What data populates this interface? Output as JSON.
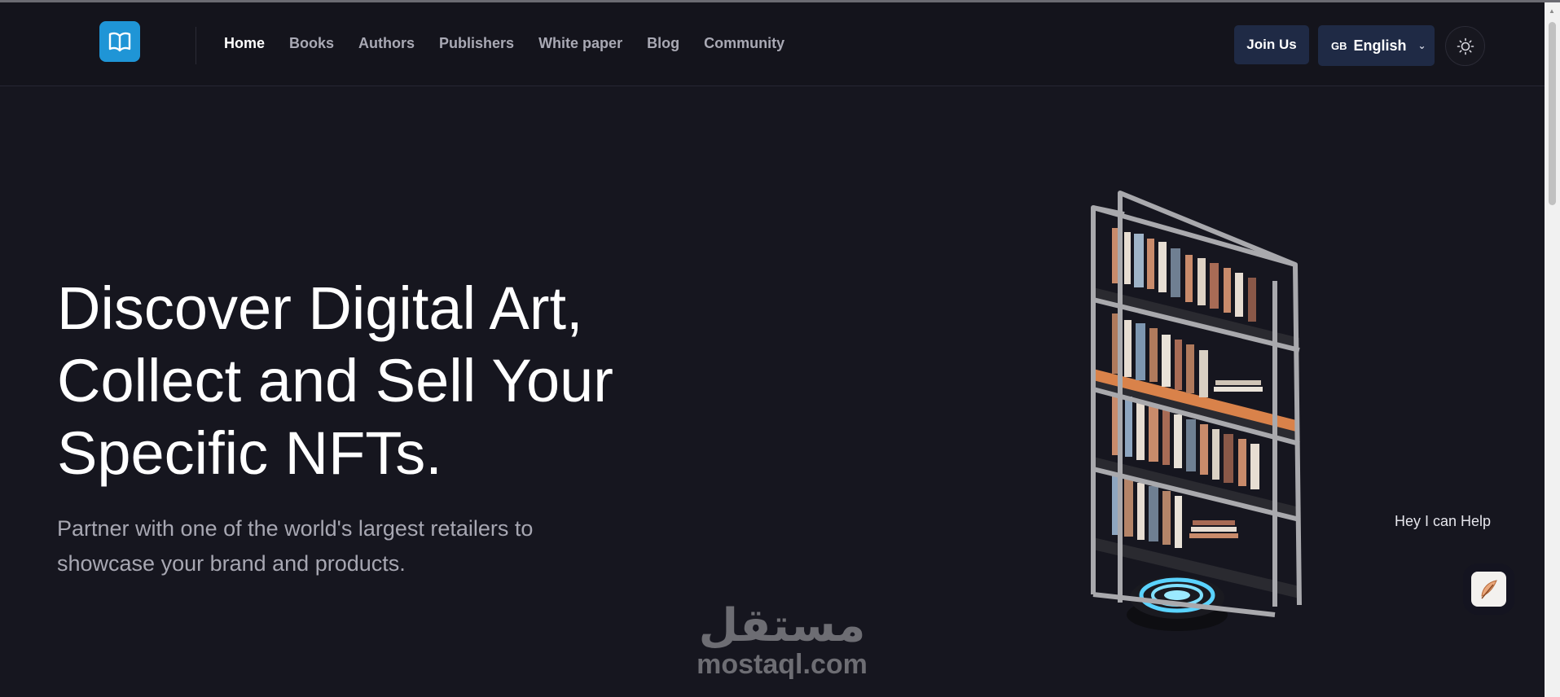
{
  "header": {
    "logo_icon": "open-book-icon",
    "nav": [
      {
        "label": "Home",
        "active": true
      },
      {
        "label": "Books"
      },
      {
        "label": "Authors"
      },
      {
        "label": "Publishers"
      },
      {
        "label": "White paper"
      },
      {
        "label": "Blog"
      },
      {
        "label": "Community"
      }
    ],
    "join_label": "Join Us",
    "language": {
      "flag": "GB",
      "label": "English"
    },
    "theme_icon": "sun-icon"
  },
  "hero": {
    "title_line1": "Discover Digital Art,",
    "title_line2": "Collect and Sell Your",
    "title_line3": "Specific NFTs.",
    "subtitle_line1": "Partner with one of the world's largest retailers to",
    "subtitle_line2": "showcase your brand and products."
  },
  "watermark": {
    "arabic": "مستقل",
    "url": "mostaql.com"
  },
  "help": {
    "text": "Hey I can Help",
    "icon": "feather-icon"
  },
  "colors": {
    "background": "#16161f",
    "accent": "#1f95d6",
    "button": "#1f2a45"
  }
}
